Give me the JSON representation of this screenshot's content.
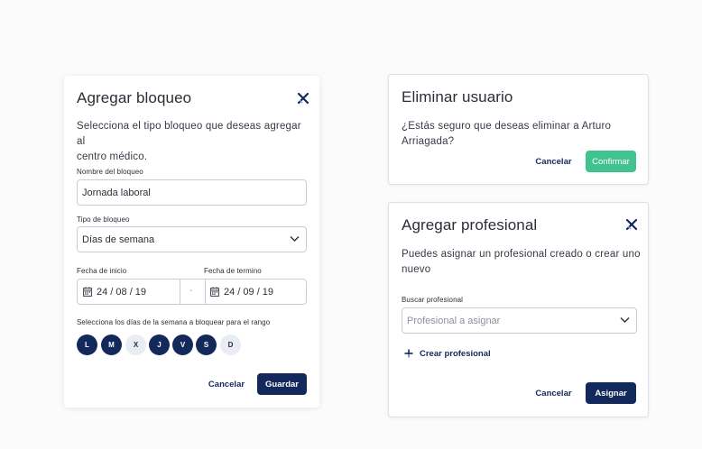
{
  "block_dialog": {
    "title": "Agregar bloqueo",
    "description_line1": "Selecciona el tipo bloqueo que deseas agregar al",
    "description_line2": "centro médico.",
    "name_label": "Nombre del bloqueo",
    "name_value": "Jornada laboral",
    "type_label": "Tipo de bloqueo",
    "type_value": "Días de semana",
    "start_label": "Fecha de inicio",
    "start_value": "24 / 08 / 19",
    "end_label": "Fecha de termino",
    "end_value": "24 / 09 / 19",
    "range_separator": "-",
    "days_label": "Selecciona los días de la semana a bloquear para el rango",
    "days": [
      {
        "letter": "L",
        "selected": true
      },
      {
        "letter": "M",
        "selected": true
      },
      {
        "letter": "X",
        "selected": false
      },
      {
        "letter": "J",
        "selected": true
      },
      {
        "letter": "V",
        "selected": true
      },
      {
        "letter": "S",
        "selected": true
      },
      {
        "letter": "D",
        "selected": false
      }
    ],
    "cancel_label": "Cancelar",
    "save_label": "Guardar"
  },
  "delete_dialog": {
    "title": "Eliminar usuario",
    "description_line1": "¿Estás seguro que deseas eliminar a Arturo",
    "description_line2": "Arriagada?",
    "cancel_label": "Cancelar",
    "confirm_label": "Confirmar"
  },
  "professional_dialog": {
    "title": "Agregar profesional",
    "description_line1": "Puedes asignar un profesional creado o crear uno",
    "description_line2": "nuevo",
    "search_label": "Buscar profesional",
    "search_placeholder": "Profesional a asignar",
    "create_label": "Crear profesional",
    "cancel_label": "Cancelar",
    "assign_label": "Asignar"
  },
  "colors": {
    "primary": "#13295b",
    "confirm": "#41c28e",
    "day_off": "#e9ecf3"
  },
  "icons": {
    "close": "close-icon",
    "chevron": "chevron-down-icon",
    "calendar": "calendar-icon",
    "plus": "plus-icon"
  }
}
